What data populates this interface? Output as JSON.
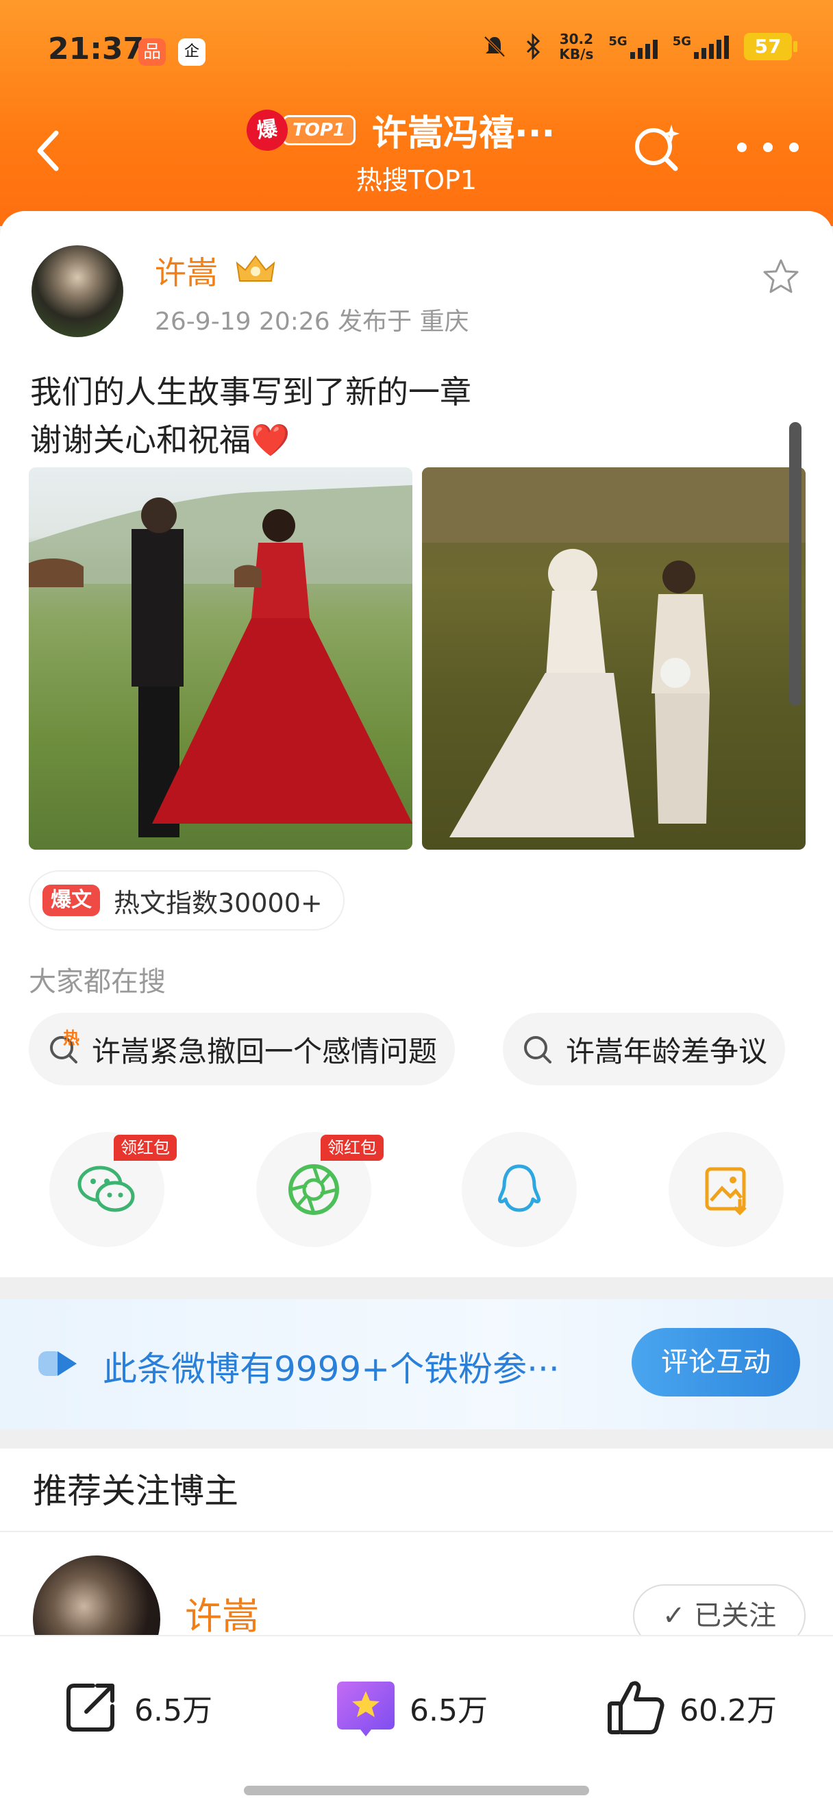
{
  "status_bar": {
    "time": "21:37",
    "app_icon_1": "品",
    "app_icon_2": "企",
    "net_speed_value": "30.2",
    "net_speed_unit": "KB/s",
    "sim1": "5G",
    "sim2": "5G",
    "battery": "57",
    "icons": [
      "mute-bell-icon",
      "bluetooth-icon"
    ]
  },
  "header": {
    "badge_char": "爆",
    "badge_top": "TOP1",
    "title": "许嵩冯禧···",
    "subtitle": "热搜TOP1",
    "colors": {
      "gradient_top": "#ff9a2a",
      "gradient_bottom": "#ff6f10"
    }
  },
  "post": {
    "author": "许嵩",
    "meta": "26-9-19 20:26  发布于 重庆",
    "line1": "我们的人生故事写到了新的一章",
    "line2": "谢谢关心和祝福",
    "heart": "❤️",
    "hot_tag": "爆文",
    "hot_index": "热文指数30000+"
  },
  "searching": {
    "header": "大家都在搜",
    "hot_mark": "热",
    "items": [
      "许嵩紧急撤回一个感情问题",
      "许嵩年龄差争议"
    ]
  },
  "share": {
    "red_packet_label": "领红包",
    "items": [
      "wechat-icon",
      "moments-icon",
      "qq-icon",
      "save-image-icon"
    ]
  },
  "fans": {
    "text": "此条微博有9999+个铁粉参···",
    "button": "评论互动",
    "accent": "#2a7fd8"
  },
  "recommend": {
    "header": "推荐关注博主",
    "name": "许嵩",
    "follow": "✓ 已关注"
  },
  "bottom_bar": {
    "repost": "6.5万",
    "comment": "6.5万",
    "like": "60.2万"
  }
}
